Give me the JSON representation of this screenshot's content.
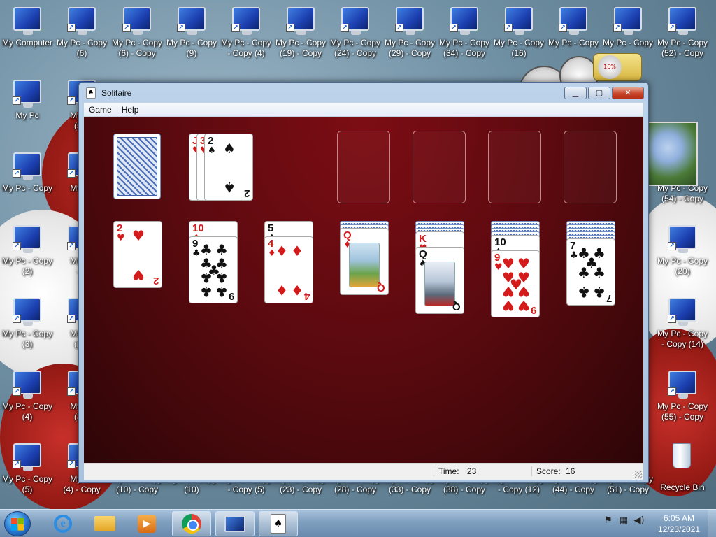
{
  "desktop": {
    "icons": [
      {
        "label": "My Computer"
      },
      {
        "label": "My Pc - Copy\n(6)"
      },
      {
        "label": "My Pc - Copy\n(6) - Copy"
      },
      {
        "label": "My Pc - Copy\n(9)"
      },
      {
        "label": "My Pc - Copy\n- Copy (4)"
      },
      {
        "label": "My Pc - Copy\n(19) - Copy"
      },
      {
        "label": "My Pc - Copy\n(24) - Copy"
      },
      {
        "label": "My Pc - Copy\n(29) - Copy"
      },
      {
        "label": "My Pc - Copy\n(34) - Copy"
      },
      {
        "label": "My Pc - Copy\n(16)"
      },
      {
        "label": "My Pc - Copy"
      },
      {
        "label": "My Pc - Copy"
      },
      {
        "label": "My Pc - Copy\n(52) - Copy"
      },
      {
        "label": "My Pc"
      },
      {
        "label": "My Pc\n(5) -"
      },
      {
        "label": "My Pc - Copy\n(54) - Copy"
      },
      {
        "label": "My Pc - Copy"
      },
      {
        "label": "My Pc"
      },
      {
        "label": "My Pc - Copy\n(2)"
      },
      {
        "label": "My Pc\n- C"
      },
      {
        "label": "My Pc - Copy\n(20)"
      },
      {
        "label": "My Pc - Copy\n(3)"
      },
      {
        "label": "My Pc\n(2) -"
      },
      {
        "label": "My Pc - Copy\n- Copy (14)"
      },
      {
        "label": "My Pc - Copy\n(4)"
      },
      {
        "label": "My Pc\n(3) -"
      },
      {
        "label": "My Pc - Copy\n(55) - Copy"
      },
      {
        "label": "My Pc - Copy\n(5)"
      },
      {
        "label": "My Pc\n(4) - Copy"
      },
      {
        "label": "My Pc - Copy\n(10) - Copy"
      },
      {
        "label": "My Pc - Copy\n(10)"
      },
      {
        "label": "My Pc - Copy\n- Copy (5)"
      },
      {
        "label": "My Pc - Copy\n(23) - Copy"
      },
      {
        "label": "My Pc - Copy\n(28) - Copy"
      },
      {
        "label": "My Pc - Copy\n(33) - Copy"
      },
      {
        "label": "My Pc - Copy\n(38) - Copy"
      },
      {
        "label": "My Pc - Copy\n- Copy (12)"
      },
      {
        "label": "My Pc - Copy\n(44) - Copy"
      },
      {
        "label": "My Pc - Copy\n(51) - Copy"
      },
      {
        "label": "Recycle Bin"
      }
    ],
    "gadgets": {
      "cpu_meter_percent": "16%"
    }
  },
  "window": {
    "title": "Solitaire",
    "controls": {
      "minimize": "▁",
      "maximize": "▢",
      "close": "✕"
    },
    "menu": [
      "Game",
      "Help"
    ],
    "status": {
      "time_label": "Time:",
      "time_value": "23",
      "score_label": "Score:",
      "score_value": "16"
    }
  },
  "game": {
    "stock": {
      "face": "back"
    },
    "waste": [
      {
        "rank": "J",
        "suit": "♥",
        "color": "red"
      },
      {
        "rank": "3",
        "suit": "♥",
        "color": "red"
      },
      {
        "rank": "2",
        "suit": "♠",
        "color": "black"
      }
    ],
    "foundations": [
      "empty",
      "empty",
      "empty",
      "empty"
    ],
    "tableau": [
      {
        "hidden": 0,
        "cards": [
          {
            "rank": "2",
            "suit": "♥",
            "color": "red"
          }
        ]
      },
      {
        "hidden": 0,
        "cards": [
          {
            "rank": "10",
            "suit": "♦",
            "color": "red"
          },
          {
            "rank": "9",
            "suit": "♣",
            "color": "black"
          }
        ]
      },
      {
        "hidden": 0,
        "cards": [
          {
            "rank": "5",
            "suit": "♠",
            "color": "black"
          },
          {
            "rank": "4",
            "suit": "♦",
            "color": "red"
          }
        ]
      },
      {
        "hidden": 2,
        "cards": [
          {
            "rank": "Q",
            "suit": "♦",
            "color": "red"
          }
        ]
      },
      {
        "hidden": 3,
        "cards": [
          {
            "rank": "K",
            "suit": "♥",
            "color": "red"
          },
          {
            "rank": "Q",
            "suit": "♠",
            "color": "black"
          }
        ]
      },
      {
        "hidden": 4,
        "cards": [
          {
            "rank": "10",
            "suit": "♠",
            "color": "black"
          },
          {
            "rank": "9",
            "suit": "♥",
            "color": "red"
          }
        ]
      },
      {
        "hidden": 5,
        "cards": [
          {
            "rank": "7",
            "suit": "♣",
            "color": "black"
          }
        ]
      }
    ]
  },
  "taskbar": {
    "clock_time": "6:05 AM",
    "clock_date": "12/23/2021",
    "apps": [
      "internet-explorer",
      "windows-explorer",
      "media-player",
      "chrome",
      "remote-desktop",
      "solitaire"
    ]
  }
}
